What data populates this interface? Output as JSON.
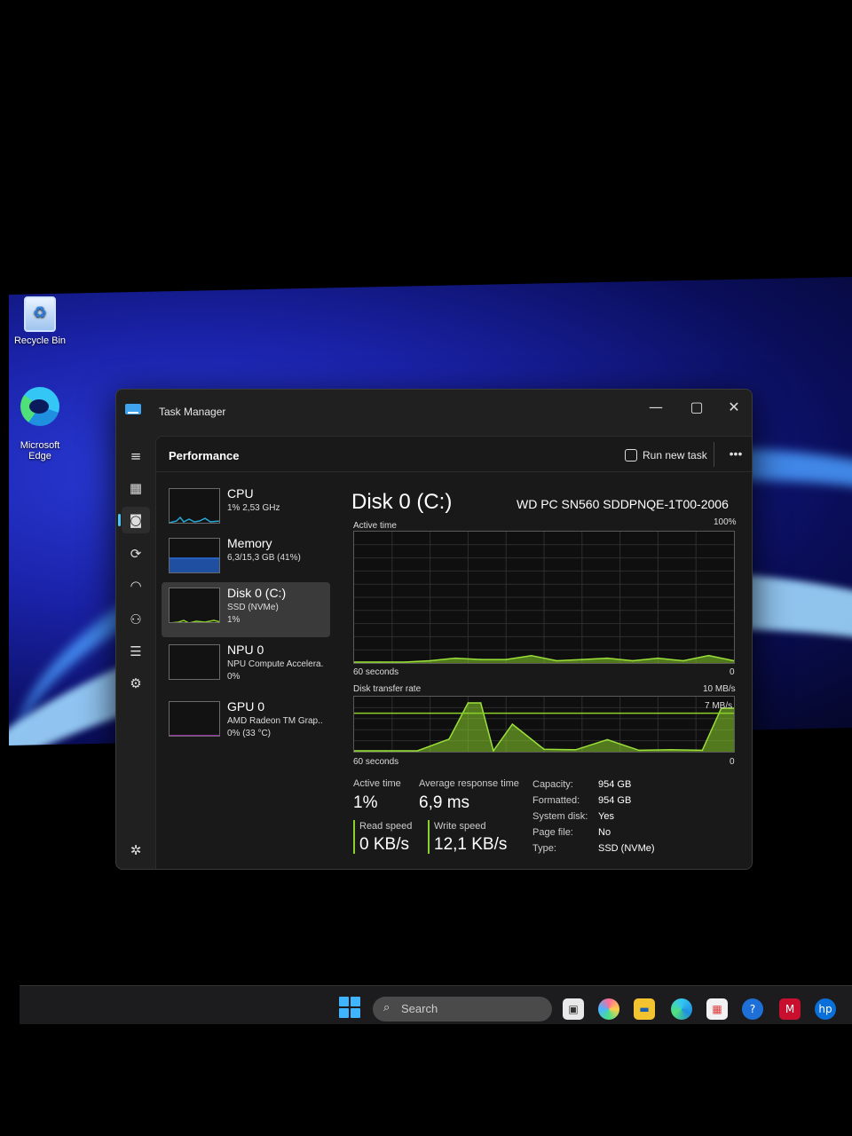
{
  "desktop": {
    "icons": [
      {
        "label": "Recycle Bin",
        "icon": "recycle-bin-icon"
      },
      {
        "label": "Microsoft\nEdge",
        "icon": "edge-icon"
      }
    ]
  },
  "window": {
    "title": "Task Manager",
    "controls": {
      "minimize": "—",
      "maximize": "▢",
      "close": "✕"
    }
  },
  "nav": {
    "items": [
      {
        "name": "hamburger-menu-icon",
        "glyph": "≡"
      },
      {
        "name": "processes-icon",
        "glyph": "▦"
      },
      {
        "name": "performance-icon",
        "glyph": "◙",
        "active": true
      },
      {
        "name": "app-history-icon",
        "glyph": "⟳"
      },
      {
        "name": "startup-apps-icon",
        "glyph": "◠"
      },
      {
        "name": "users-icon",
        "glyph": "⚇"
      },
      {
        "name": "details-icon",
        "glyph": "☰"
      },
      {
        "name": "services-icon",
        "glyph": "⚙"
      },
      {
        "name": "settings-icon",
        "glyph": "✲"
      }
    ]
  },
  "header": {
    "title": "Performance",
    "run_new_task": "Run new task",
    "more": "•••"
  },
  "resources": [
    {
      "name": "CPU",
      "sub": "1% 2,53 GHz",
      "sub2": "",
      "thumb_color": "#2aa8d8"
    },
    {
      "name": "Memory",
      "sub": "6,3/15,3 GB (41%)",
      "sub2": "",
      "thumb_color": "#2a6fd8"
    },
    {
      "name": "Disk 0 (C:)",
      "sub": "SSD (NVMe)",
      "sub2": "1%",
      "thumb_color": "#8bd12a",
      "selected": true
    },
    {
      "name": "NPU 0",
      "sub": "NPU Compute Accelera.",
      "sub2": "0%",
      "thumb_color": "#555555"
    },
    {
      "name": "GPU 0",
      "sub": "AMD Radeon TM Grap..",
      "sub2": "0% (33 °C)",
      "thumb_color": "#c040d0"
    }
  ],
  "detail": {
    "title": "Disk 0 (C:)",
    "model": "WD PC SN560 SDDPNQE-1T00-2006",
    "active_time_graph": {
      "label": "Active time",
      "max": "100%",
      "duration": "60 seconds",
      "min": "0"
    },
    "transfer_graph": {
      "label": "Disk transfer rate",
      "max": "10 MB/s",
      "ref_line": "7 MB/s",
      "duration": "60 seconds",
      "min": "0"
    },
    "stats": {
      "active_time_label": "Active time",
      "active_time": "1%",
      "avg_response_label": "Average response time",
      "avg_response": "6,9 ms",
      "read_speed_label": "Read speed",
      "read_speed": "0 KB/s",
      "write_speed_label": "Write speed",
      "write_speed": "12,1 KB/s"
    },
    "properties": [
      {
        "label": "Capacity:",
        "value": "954 GB"
      },
      {
        "label": "Formatted:",
        "value": "954 GB"
      },
      {
        "label": "System disk:",
        "value": "Yes"
      },
      {
        "label": "Page file:",
        "value": "No"
      },
      {
        "label": "Type:",
        "value": "SSD (NVMe)"
      }
    ]
  },
  "taskbar": {
    "search_placeholder": "Search",
    "apps": [
      "task-view-icon",
      "copilot-icon",
      "file-explorer-icon",
      "edge-icon",
      "store-icon",
      "help-icon",
      "mcafee-icon",
      "hp-icon"
    ]
  },
  "chart_data": [
    {
      "type": "area",
      "title": "Active time",
      "ylim": [
        0,
        100
      ],
      "x": [
        0,
        4,
        8,
        12,
        16,
        20,
        24,
        28,
        32,
        36,
        40,
        44,
        48,
        52,
        56,
        60
      ],
      "values": [
        0,
        0,
        0,
        1,
        3,
        2,
        2,
        5,
        1,
        2,
        3,
        1,
        3,
        1,
        5,
        1
      ]
    },
    {
      "type": "area",
      "title": "Disk transfer rate",
      "ylim": [
        0,
        10
      ],
      "x": [
        0,
        5,
        10,
        15,
        18,
        20,
        22,
        25,
        30,
        35,
        40,
        45,
        50,
        55,
        58,
        60
      ],
      "values": [
        0,
        0,
        0,
        2.2,
        9,
        9,
        0,
        5,
        0.3,
        0.2,
        2.1,
        0.1,
        0.2,
        0.1,
        8,
        8
      ]
    }
  ]
}
